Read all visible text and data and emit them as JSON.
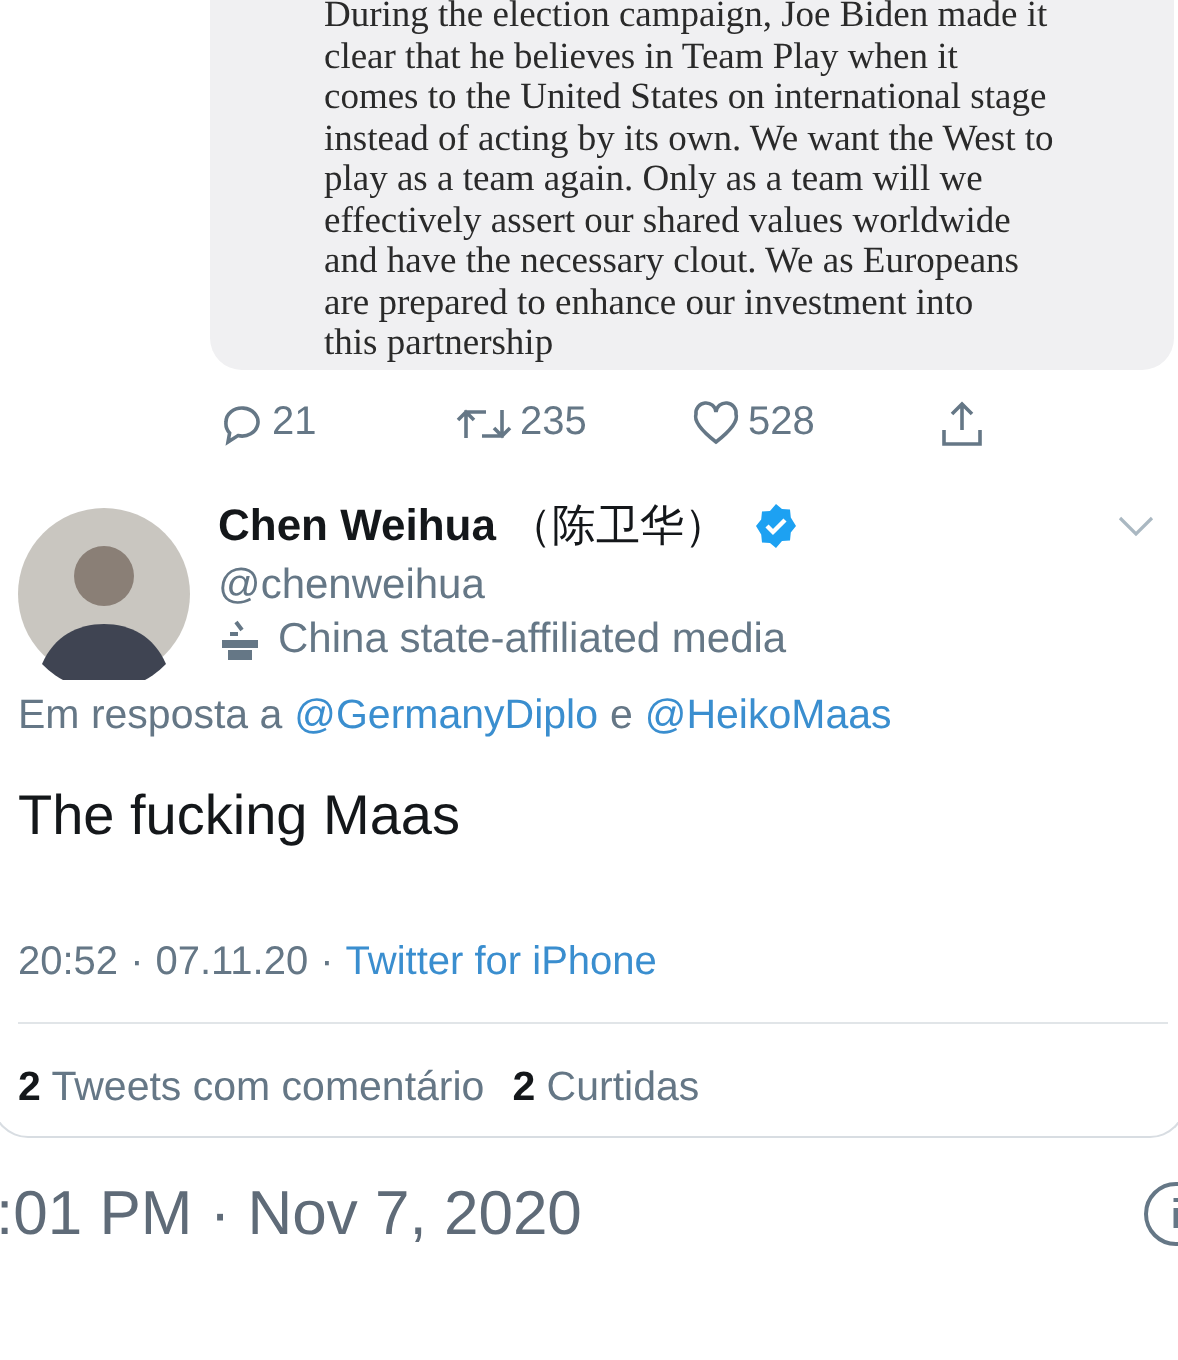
{
  "quoted_tweet": {
    "lines": [
      "During the election campaign, Joe Biden made it",
      "clear that he believes in Team Play when it",
      "comes to the United States on international stage",
      "instead of acting by its own. We want the West to",
      "play as a team again. Only as a team will we",
      "effectively assert our shared values worldwide",
      "and have the necessary clout. We as Europeans",
      "are prepared to enhance our investment into",
      "this partnership"
    ]
  },
  "quoted_actions": [
    {
      "kind": "reply",
      "count": "21"
    },
    {
      "kind": "retweet",
      "count": "235"
    },
    {
      "kind": "like",
      "count": "528"
    },
    {
      "kind": "share"
    }
  ],
  "tweet": {
    "name": "Chen Weihua",
    "name_native": "（陈卫华）",
    "verified": true,
    "handle": "@chenweihua",
    "label": "China state-affiliated media",
    "reply_prefix": "Em resposta a",
    "reply_to": [
      "@GermanyDiplo",
      "@HeikoMaas"
    ],
    "reply_joiner": "e",
    "text": "The fucking Maas",
    "time": "20:52",
    "date": "07.11.20",
    "source": "Twitter for iPhone",
    "separator": "·",
    "stats": [
      {
        "count": "2",
        "label": "Tweets com comentário"
      },
      {
        "count": "2",
        "label": "Curtidas"
      }
    ]
  },
  "footer": {
    "timestamp": ":01 PM · Nov 7, 2020"
  }
}
